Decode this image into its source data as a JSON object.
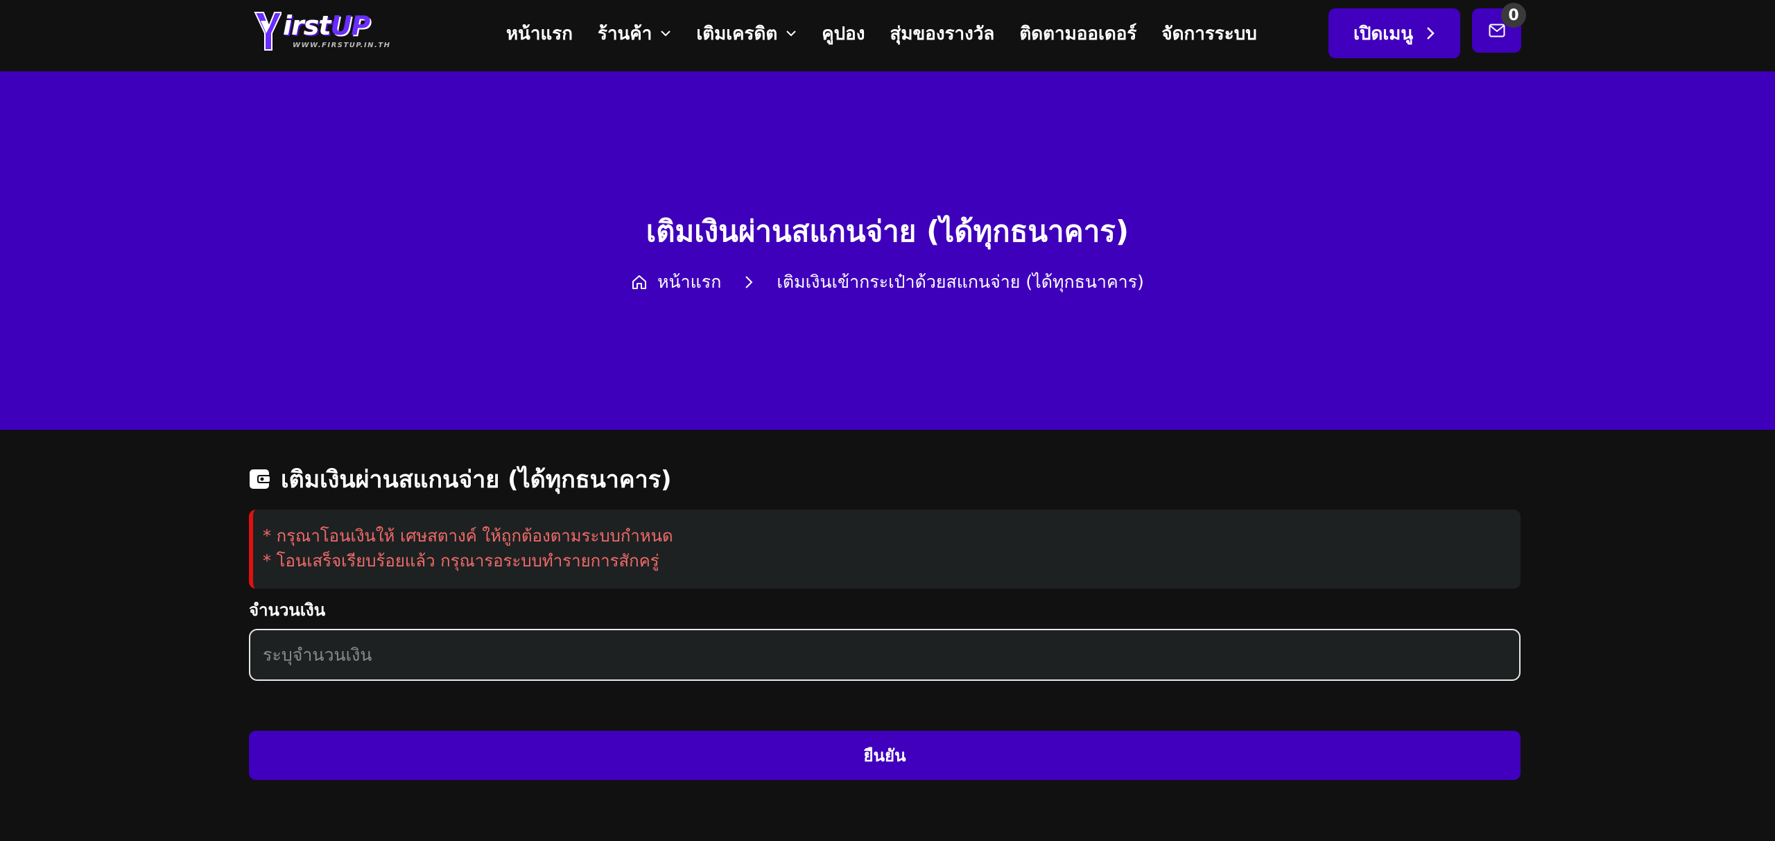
{
  "header": {
    "logo": {
      "text_main": "irst",
      "text_accent": "UP",
      "tagline": "WWW.FIRSTUP.IN.TH",
      "icon": "logo-f-icon"
    },
    "nav": [
      {
        "label": "หน้าแรก",
        "dropdown": false
      },
      {
        "label": "ร้านค้า",
        "dropdown": true
      },
      {
        "label": "เติมเครดิต",
        "dropdown": true
      },
      {
        "label": "คูปอง",
        "dropdown": false
      },
      {
        "label": "สุ่มของรางวัล",
        "dropdown": false
      },
      {
        "label": "ติดตามออเดอร์",
        "dropdown": false
      },
      {
        "label": "จัดการระบบ",
        "dropdown": false
      }
    ],
    "open_menu_label": "เปิดเมนู",
    "mail_count": "0"
  },
  "hero": {
    "title": "เติมเงินผ่านสแกนจ่าย (ได้ทุกธนาคาร)",
    "breadcrumb": {
      "home": "หน้าแรก",
      "current": "เติมเงินเข้ากระเป๋าด้วยสแกนจ่าย (ได้ทุกธนาคาร)"
    }
  },
  "form": {
    "section_title": "เติมเงินผ่านสแกนจ่าย (ได้ทุกธนาคาร)",
    "notices": [
      "* กรุณาโอนเงินให้ เศษสตางค์ ให้ถูกต้องตามระบบกำหนด",
      "* โอนเสร็จเรียบร้อยแล้ว กรุณารอระบบทำรายการสักครู่"
    ],
    "amount_label": "จำนวนเงิน",
    "amount_placeholder": "ระบุจำนวนเงิน",
    "amount_value": "",
    "confirm_label": "ยืนยัน"
  },
  "colors": {
    "brand": "#3f00bb",
    "button": "#4000be",
    "background": "#111111",
    "notice_text": "#f06a6a",
    "notice_border": "#e01010"
  }
}
